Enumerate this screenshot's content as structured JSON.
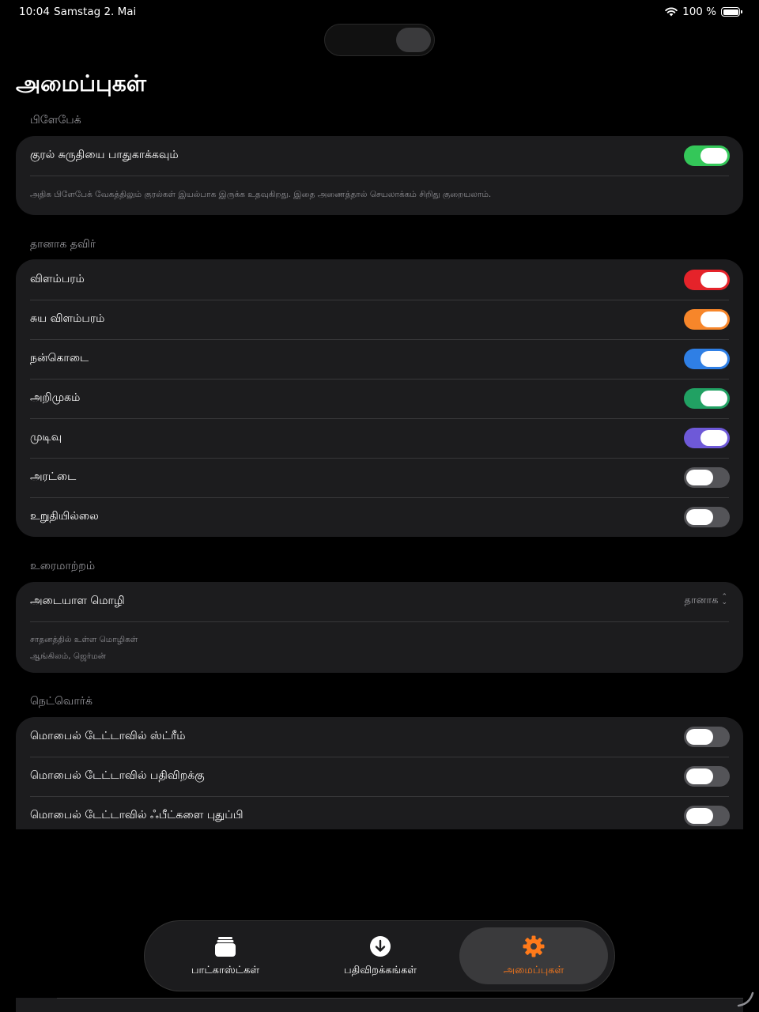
{
  "status": {
    "time": "10:04",
    "date": "Samstag 2. Mai",
    "battery": "100 %"
  },
  "title": "அமைப்புகள்",
  "playback": {
    "header": "பிளேபேக்",
    "preserve_pitch": {
      "label": "குரல் சுருதியை பாதுகாக்கவும்",
      "on": true,
      "color": "#34c759"
    },
    "footnote": "அதிக பிளேபேக் வேகத்திலும் குரல்கள் இயல்பாக இருக்க உதவுகிறது. இதை அணைத்தால் செயலாக்கம் சிறிது குறையலாம்."
  },
  "auto_skip": {
    "header": "தானாக தவிர்",
    "items": [
      {
        "label": "விளம்பரம்",
        "on": true,
        "color": "#e5232a"
      },
      {
        "label": "சுய விளம்பரம்",
        "on": true,
        "color": "#f7862a"
      },
      {
        "label": "நன்கொடை",
        "on": true,
        "color": "#2f7fe5"
      },
      {
        "label": "அறிமுகம்",
        "on": true,
        "color": "#21a163"
      },
      {
        "label": "முடிவு",
        "on": true,
        "color": "#6e59d8"
      },
      {
        "label": "அரட்டை",
        "on": false,
        "color": "#545458"
      },
      {
        "label": "உறுதியில்லை",
        "on": false,
        "color": "#545458"
      }
    ]
  },
  "transcription": {
    "header": "உரைமாற்றம்",
    "language_label": "அடையாள மொழி",
    "language_value": "தானாக",
    "available_title": "சாதனத்தில் உள்ள மொழிகள்",
    "available_list": "ஆங்கிலம், ஜெர்மன்"
  },
  "network": {
    "header": "நெட்வொர்க்",
    "items": [
      {
        "label": "மொபைல் டேட்டாவில் ஸ்ட்ரீம்",
        "on": false,
        "color": "#545458"
      },
      {
        "label": "மொபைல் டேட்டாவில் பதிவிறக்கு",
        "on": false,
        "color": "#545458"
      },
      {
        "label": "மொபைல் டேட்டாவில் ஃபீட்களை புதுப்பி",
        "on": false,
        "color": "#545458"
      }
    ]
  },
  "tabs": [
    {
      "label": "பாட்காஸ்ட்கள்",
      "icon": "stack-icon"
    },
    {
      "label": "பதிவிறக்கங்கள்",
      "icon": "download-icon"
    },
    {
      "label": "அமைப்புகள்",
      "icon": "gear-icon",
      "active": true
    }
  ],
  "accent_color": "#ff7a1a"
}
